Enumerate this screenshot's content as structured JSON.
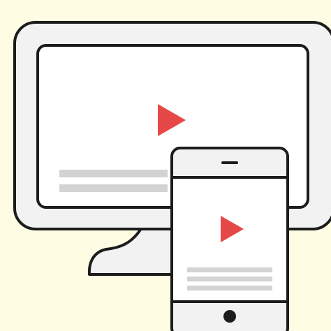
{
  "colors": {
    "background": "#fefce3",
    "outline": "#1c1c1c",
    "device_body": "#f2f2f2",
    "screen": "#ffffff",
    "placeholder_line": "#d3d3d3",
    "play_accent": "#e64848"
  },
  "icons": {
    "desktop_play": "play-triangle",
    "tablet_play": "play-triangle",
    "home_button": "filled-circle",
    "speaker": "rounded-bar"
  }
}
